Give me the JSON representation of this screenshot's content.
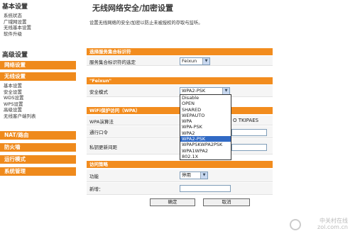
{
  "sidebar": {
    "basic_header": "基本设置",
    "basic_items": [
      "系统状态",
      "广域网设置",
      "无线基本设置",
      "软件升级"
    ],
    "advanced_header": "高级设置",
    "network_label": "网络设置",
    "wireless_label": "无线设置",
    "wireless_items": [
      "基本设置",
      "安全设置",
      "WDS设置",
      "WPS设置",
      "高级设置",
      "无线客户端列表"
    ],
    "nat_label": "NAT/路由",
    "firewall_label": "防火墙",
    "mode_label": "运行模式",
    "system_label": "系统管理"
  },
  "main": {
    "title": "无线网络安全/加密设置",
    "description": "设置无线网络的安全/加密以防止未被授权的存取与监听。",
    "ssid_section": "选择服务集合标识符",
    "ssid_label": "服务集合标识符的选定",
    "ssid_value": "Feixun",
    "profile_section": "\"Feixun\"",
    "mode_label": "安全模式",
    "mode_value": "WPA2-PSK",
    "mode_options": [
      "Disable",
      "OPEN",
      "SHARED",
      "WEPAUTO",
      "WPA",
      "WPA-PSK",
      "WPA2",
      "WPA2-PSK",
      "WPAPSKWPA2PSK",
      "WPA1WPA2",
      "802.1X"
    ],
    "mode_selected_index": 7,
    "wpa_section": "WiFi保护访问（WPA）",
    "wpa_algo_label": "WPA演算法",
    "wpa_algo_tail": "O TKIPAES",
    "pass_label": "通行口令",
    "rekey_label": "私钥更新间距",
    "policy_section": "访问策略",
    "policy_label": "功能",
    "policy_value": "停用",
    "new_label": "新增：",
    "ok_label": "确定",
    "cancel_label": "取消"
  },
  "watermark": {
    "cn": "中关村在线",
    "url": "zol.com.cn"
  }
}
